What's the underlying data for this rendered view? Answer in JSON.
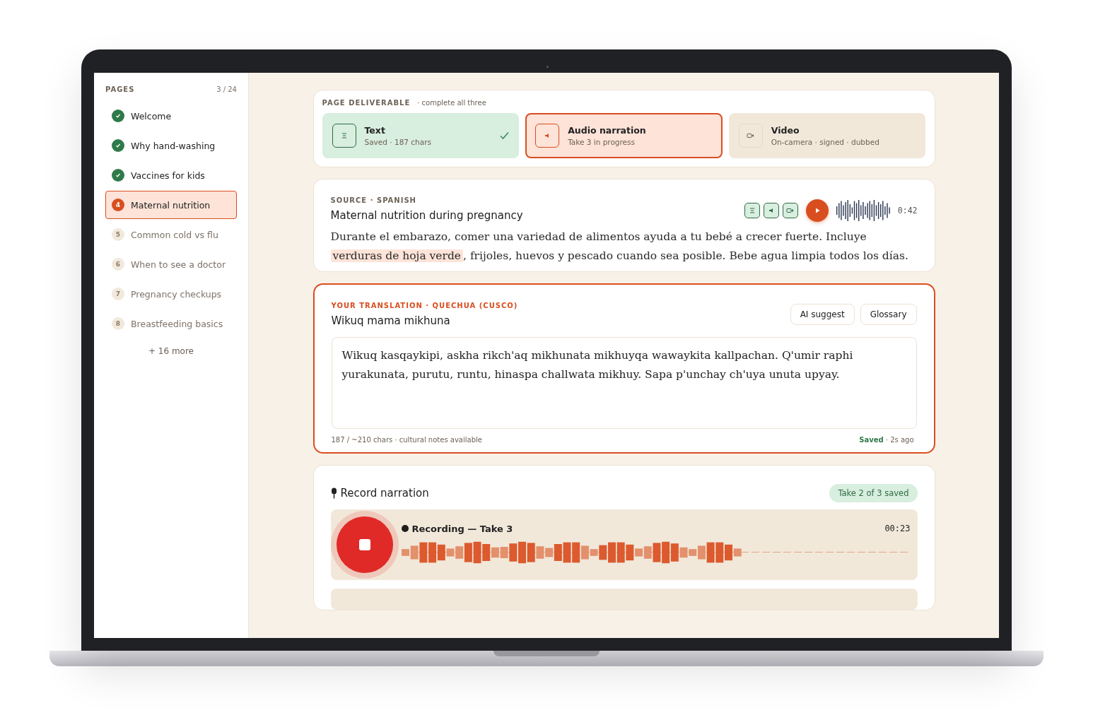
{
  "sidebar": {
    "heading": "PAGES",
    "count": "3 / 24",
    "items": [
      {
        "label": "Welcome",
        "done": true,
        "selected": false
      },
      {
        "label": "Why hand-washing",
        "done": true,
        "selected": false
      },
      {
        "label": "Vaccines for kids",
        "done": true,
        "selected": false
      },
      {
        "number": "4",
        "label": "Maternal nutrition",
        "done": false,
        "selected": true
      },
      {
        "number": "5",
        "label": "Common cold vs flu",
        "done": false,
        "selected": false
      },
      {
        "number": "6",
        "label": "When to see a doctor",
        "done": false,
        "selected": false
      },
      {
        "number": "7",
        "label": "Pregnancy checkups",
        "done": false,
        "selected": false
      },
      {
        "number": "8",
        "label": "Breastfeeding basics",
        "done": false,
        "selected": false
      }
    ],
    "more": "+ 16 more"
  },
  "deliverable": {
    "label": "PAGE DELIVERABLE",
    "hint": "· complete all three",
    "options": [
      {
        "kind": "text",
        "title": "Text",
        "subtitle": "Saved · 187 chars",
        "done": true,
        "selected": false
      },
      {
        "kind": "audio",
        "title": "Audio narration",
        "subtitle": "Take 3 in progress",
        "done": false,
        "selected": true
      },
      {
        "kind": "video",
        "title": "Video",
        "subtitle": "On-camera · signed · dubbed",
        "done": false,
        "selected": false
      }
    ]
  },
  "source": {
    "label": "SOURCE · SPANISH",
    "title": "Maternal nutrition during pregnancy",
    "duration": "0:42",
    "paragraph": [
      {
        "text": "Durante el embarazo, comer una variedad de alimentos ayuda a tu bebé a crecer fuerte. Incluye ",
        "highlighted": false
      },
      {
        "text": "verduras de hoja verde",
        "highlighted": true
      },
      {
        "text": ", frijoles, huevos y pescado cuando sea posible. Bebe agua limpia todos los días.",
        "highlighted": false
      }
    ]
  },
  "translation": {
    "label": "YOUR TRANSLATION · QUECHUA (CUSCO)",
    "title": "Wikuq mama mikhuna",
    "buttons": [
      "AI suggest",
      "Glossary"
    ],
    "value": "Wikuq kasqaykipi, askha rikch'aq mikhunata mikhuyqa wawaykita kallpachan. Q'umir raphi yurakunata, purutu, runtu, hinaspa challwata mikhuy. Sapa p'unchay ch'uya unuta upyay.",
    "counter": "187 / ~210 chars · cultural notes available",
    "status": "Saved",
    "time": "· 2s ago"
  },
  "record": {
    "title": "Record narration",
    "badge": "Take 2 of 3 saved",
    "take": {
      "label": "Recording — Take 3",
      "time": "00:23",
      "recording": true,
      "level": 0.67
    }
  }
}
